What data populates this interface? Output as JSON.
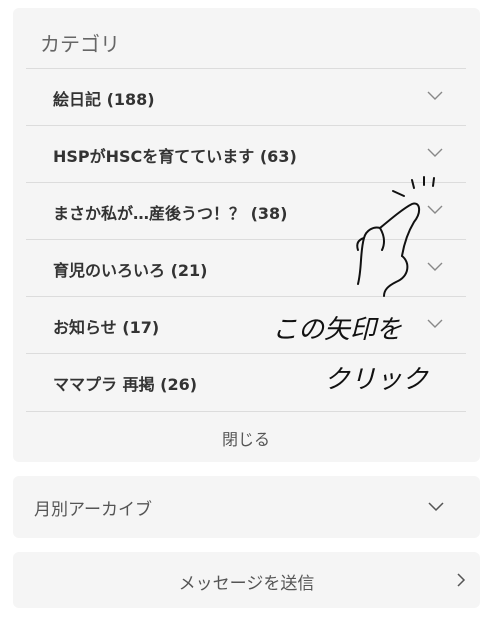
{
  "categories": {
    "title": "カテゴリ",
    "items": [
      {
        "label": "絵日記 (188)"
      },
      {
        "label": "HSPがHSCを育てています (63)"
      },
      {
        "label": "まさか私が…産後うつ！？ (38)"
      },
      {
        "label": "育児のいろいろ (21)"
      },
      {
        "label": "お知らせ (17)"
      },
      {
        "label": "ママプラ 再掲 (26)"
      }
    ],
    "close_label": "閉じる"
  },
  "archive": {
    "label": "月別アーカイブ"
  },
  "message": {
    "label": "メッセージを送信"
  },
  "annotation": {
    "line1": "この矢印を",
    "line2": "クリック"
  },
  "icons": {
    "row_chevron": "chevron-down-icon",
    "message_chevron": "chevron-right-icon",
    "pointing_hand": "pointing-hand-icon"
  }
}
